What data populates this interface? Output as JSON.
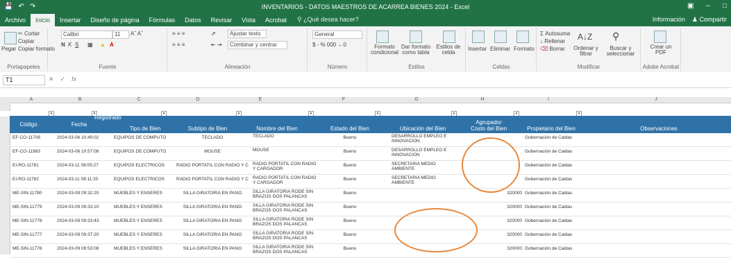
{
  "window": {
    "title": "INVENTARIOS - DATOS MAESTROS DE ACARREA BIENES 2024 - Excel",
    "user": "Información",
    "share": "Compartir"
  },
  "ribbon_tabs": [
    "Archivo",
    "Inicio",
    "Insertar",
    "Diseño de página",
    "Fórmulas",
    "Datos",
    "Revisar",
    "Vista",
    "Acrobat"
  ],
  "search_placeholder": "¿Qué desea hacer?",
  "ribbon": {
    "clipboard": {
      "paste": "Pegar",
      "cut": "Cortar",
      "copy": "Copiar",
      "format_painter": "Copiar formato",
      "label": "Portapapeles"
    },
    "font": {
      "name": "Calibri",
      "size": "11",
      "label": "Fuente"
    },
    "alignment": {
      "wrap": "Ajustar texto",
      "merge": "Combinar y centrar",
      "label": "Alineación"
    },
    "number": {
      "format": "General",
      "label": "Número"
    },
    "styles": {
      "conditional": "Formato condicional",
      "table": "Dar formato como tabla",
      "cell": "Estilos de celda",
      "label": "Estilos"
    },
    "cells": {
      "insert": "Insertar",
      "delete": "Eliminar",
      "format": "Formato",
      "label": "Celdas"
    },
    "editing": {
      "autosum": "Autosuma",
      "fill": "Rellenar",
      "clear": "Borrar",
      "sort": "Ordenar y filtrar",
      "find": "Buscar y seleccionar",
      "label": "Modificar"
    },
    "acrobat": {
      "create": "Crear un PDF",
      "label": "Adobe Acrobat"
    }
  },
  "formula_bar": {
    "name_box": "T1",
    "fx": "fx"
  },
  "columns": [
    "A",
    "B",
    "C",
    "D",
    "E",
    "F",
    "G",
    "H",
    "I",
    "J",
    "K"
  ],
  "table_headers": {
    "codigo": "Código",
    "fecha": "Fecha",
    "registrado": "Registrado",
    "tipo": "Tipo de Bien",
    "subtipo": "Subtipo de Bien",
    "nombre": "Nombre del Bien",
    "estado": "Estado del Bien",
    "agrupador": "Agrupador",
    "ubicacion": "Ubicación del Bien",
    "costo": "Costo del Bien",
    "propietario": "Propietario del Bien",
    "observaciones": "Observaciones"
  },
  "rows": [
    {
      "codigo": "EF-CO-11706",
      "fecha": "2024-03-06 10:49:02",
      "tipo": "EQUIPOS DE CÓMPUTO",
      "subtipo": "TECLADO",
      "nombre": "TECLADO",
      "estado": "Bueno",
      "ubicacion": "DESARROLLO EMPLEO E INNOVACION",
      "costo": "",
      "propietario": "Gobernación de Caldas"
    },
    {
      "codigo": "EF-CO-11983",
      "fecha": "2024-03-06 10:57:08",
      "tipo": "EQUIPOS DE CÓMPUTO",
      "subtipo": "MOUSE",
      "nombre": "MOUSE",
      "estado": "Bueno",
      "ubicacion": "DESARROLLO EMPLEO E INNOVACION",
      "costo": "",
      "propietario": "Gobernación de Caldas"
    },
    {
      "codigo": "EI-RO-11781",
      "fecha": "2024-03-11 08:05:27",
      "tipo": "EQUIPOS ELECTRICOS",
      "subtipo": "RADIO PORTATIL CON RADIO Y CARGADOR",
      "nombre": "RADIO PORTATIL CON RADIO Y CARGADOR",
      "estado": "Bueno",
      "ubicacion": "SECRETARIA MEDIO AMBIENTE",
      "costo": "",
      "propietario": "Gobernación de Caldas"
    },
    {
      "codigo": "EI-RO-11782",
      "fecha": "2024-03-11 08:11:20",
      "tipo": "EQUIPOS ELECTRICOS",
      "subtipo": "RADIO PORTATIL CON RADIO Y CARGADOR",
      "nombre": "RADIO PORTATIL CON RADIO Y CARGADOR",
      "estado": "Bueno",
      "ubicacion": "SECRETARIA MEDIO AMBIENTE",
      "costo": "",
      "propietario": "Gobernación de Caldas"
    },
    {
      "codigo": "ME-SIN-11780",
      "fecha": "2024-03-09 09:32:20",
      "tipo": "MUEBLES Y ENSERES",
      "subtipo": "SILLA GIRATORIA EN PAÑO",
      "nombre": "SILLA GIRATORIA RODE SIN BRAZOS DOS PALANCAS",
      "estado": "Bueno",
      "ubicacion": "",
      "costo": "320000",
      "propietario": "Gobernación de Caldas"
    },
    {
      "codigo": "ME-SIN-11779",
      "fecha": "2024-03-09 09:33:10",
      "tipo": "MUEBLES Y ENSERES",
      "subtipo": "SILLA GIRATORIA EN PAÑO",
      "nombre": "SILLA GIRATORIA RODE SIN BRAZOS DOS PALANCAS",
      "estado": "Bueno",
      "ubicacion": "",
      "costo": "320000",
      "propietario": "Gobernación de Caldas"
    },
    {
      "codigo": "ME-SIN-11778",
      "fecha": "2024-03-09 09:33:43",
      "tipo": "MUEBLES Y ENSERES",
      "subtipo": "SILLA GIRATORIA EN PAÑO",
      "nombre": "SILLA GIRATORIA RODE SIN BRAZOS DOS PALANCAS",
      "estado": "Bueno",
      "ubicacion": "",
      "costo": "320000",
      "propietario": "Gobernación de Caldas"
    },
    {
      "codigo": "ME-SIN-11777",
      "fecha": "2024-03-09 09:37:20",
      "tipo": "MUEBLES Y ENSERES",
      "subtipo": "SILLA GIRATORIA EN PAÑO",
      "nombre": "SILLA GIRATORIA RODE SIN BRAZOS DOS PALANCAS",
      "estado": "Bueno",
      "ubicacion": "",
      "costo": "320000",
      "propietario": "Gobernación de Caldas"
    },
    {
      "codigo": "ME-SIN-11776",
      "fecha": "2024-03-09 09:53:08",
      "tipo": "MUEBLES Y ENSERES",
      "subtipo": "SILLA GIRATORIA EN PAÑO",
      "nombre": "SILLA GIRATORIA RODE SIN BRAZOS DOS PALANCAS",
      "estado": "Bueno",
      "ubicacion": "",
      "costo": "320000",
      "propietario": "Gobernación de Caldas"
    }
  ],
  "colors": {
    "excel_green": "#217346",
    "header_blue": "#2f72a8",
    "annotation_orange": "#e8873a"
  }
}
